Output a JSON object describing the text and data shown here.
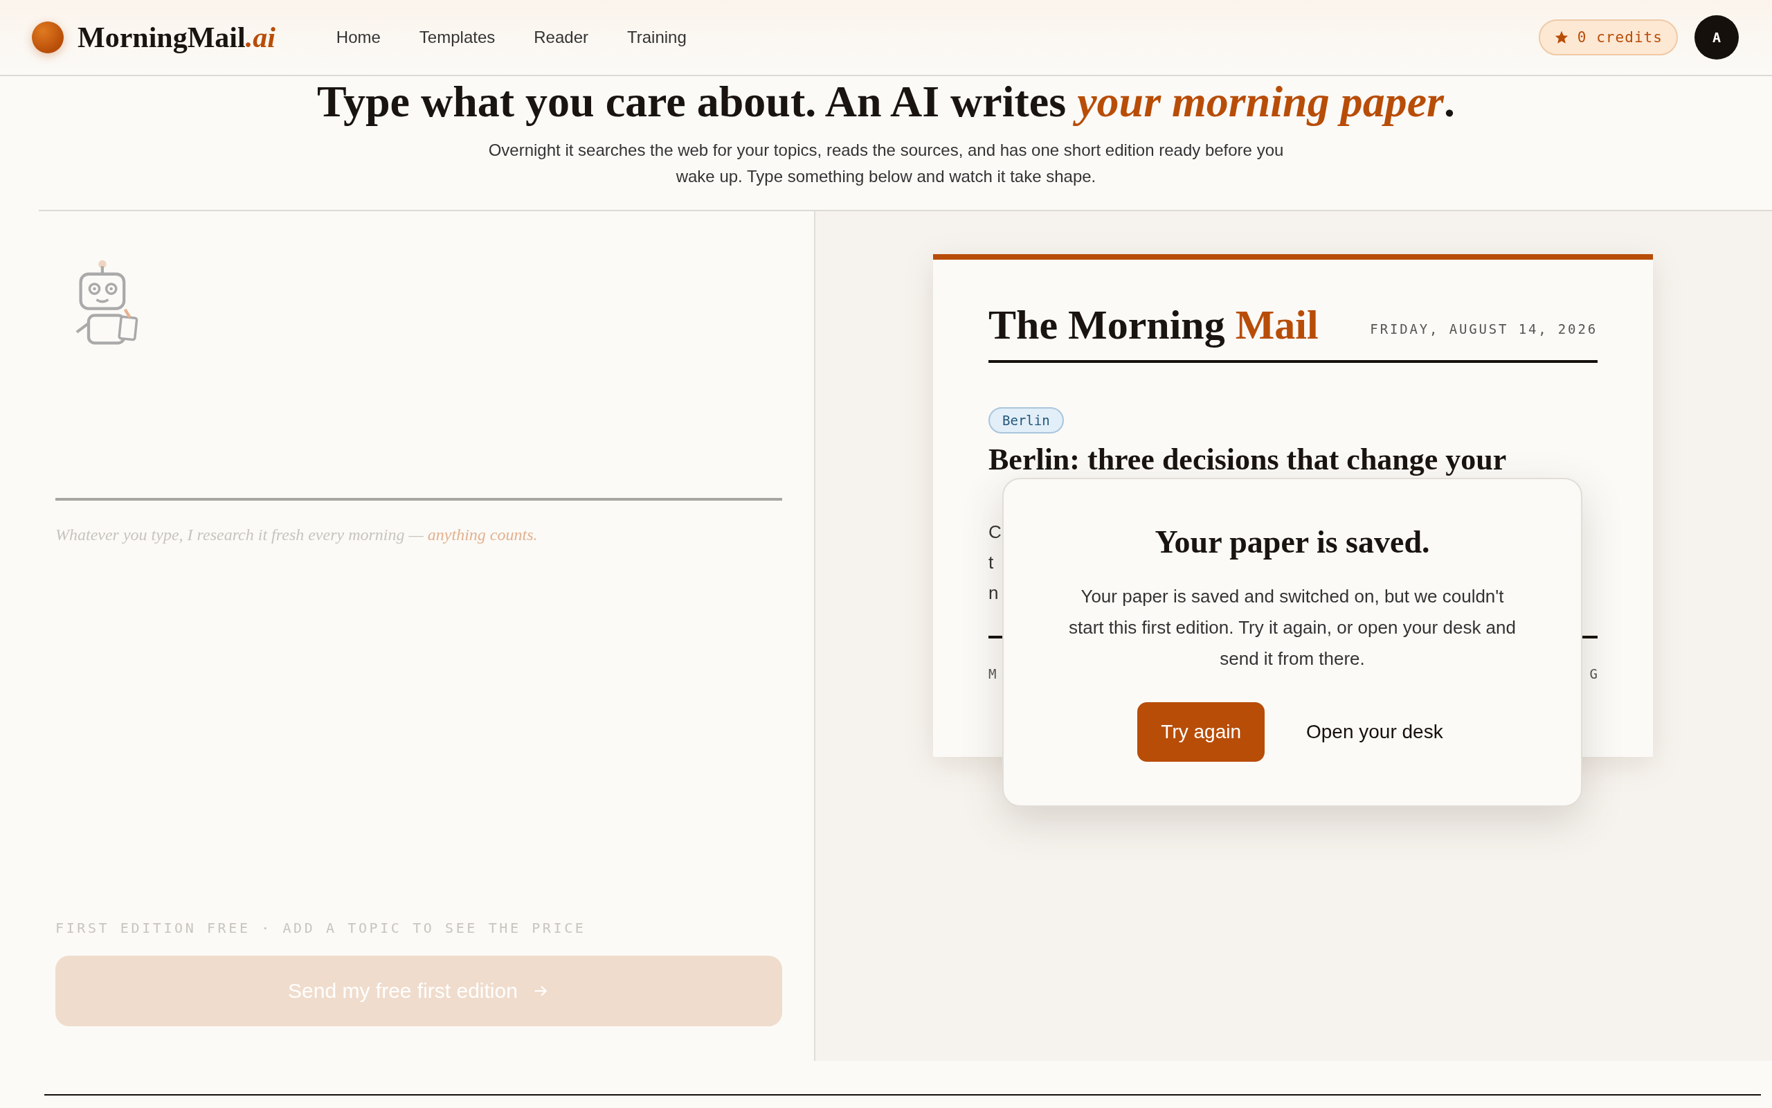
{
  "header": {
    "brand": "MorningMail",
    "brand_suffix": ".ai",
    "nav": [
      {
        "label": "Home"
      },
      {
        "label": "Templates"
      },
      {
        "label": "Reader"
      },
      {
        "label": "Training"
      }
    ],
    "credits": "0 credits",
    "avatar": "A"
  },
  "hero": {
    "title": "Type what you care about. An AI writes *your morning paper*.",
    "subtitle": "Overnight it searches the web for your topics, reads the sources, and has one short edition ready before you wake up. Type something below and watch it take shape."
  },
  "composer": {
    "hint": "Whatever you type, I research it fresh every morning — ",
    "hint_accent": "anything counts.",
    "price_note": "FIRST EDITION FREE · ADD A TOPIC TO SEE THE PRICE",
    "send_button": "Send my free first edition",
    "send_disabled": true
  },
  "preview": {
    "masthead": "The Morning ",
    "masthead_accent": "Mail",
    "date": "FRIDAY, AUGUST 14, 2026",
    "tag": "Berlin",
    "headline": "Berlin: three decisions that change your",
    "body_fragments": [
      "C",
      "t",
      "n"
    ],
    "footer_left": "M",
    "footer_right": "G"
  },
  "dialog": {
    "title": "Your paper is saved.",
    "message": "Your paper is saved and switched on, but we couldn't start this first edition. Try it again, or open your desk and send it from there.",
    "primary": "Try again",
    "secondary": "Open your desk"
  }
}
